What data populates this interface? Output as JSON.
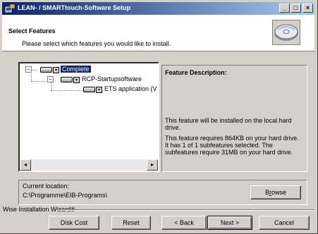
{
  "window": {
    "title": "LEAN- / SMARTtouch-Software Setup",
    "minimize_glyph": "_",
    "maximize_glyph": "□",
    "close_glyph": "×"
  },
  "header": {
    "title": "Select Features",
    "subtitle": "Please select which features you would like to install."
  },
  "tree": {
    "items": [
      {
        "label": "Complete",
        "selected": true,
        "expand": "−"
      },
      {
        "label": "RCP-Startupsoftware",
        "selected": false,
        "expand": "−"
      },
      {
        "label": "ETS application (V",
        "selected": false,
        "expand": ""
      }
    ],
    "dropdown_glyph": "▾",
    "scroll_left": "◂",
    "scroll_right": "▸"
  },
  "description": {
    "title": "Feature Description:",
    "line1": "This feature will be installed on the local hard drive.",
    "line2": "This feature requires 864KB on your hard drive. It has 1 of 1 subfeatures selected. The subfeatures require 31MB on your hard drive."
  },
  "location": {
    "label": "Current location:",
    "path": "C:\\Programme\\EIB-Programs\\",
    "browse_prefix": "B",
    "browse_ul": "r",
    "browse_suffix": "owse"
  },
  "footer": {
    "wizard_label": "Wise Installation Wizard®",
    "disk_cost": "Disk Cost",
    "reset": "Reset",
    "back": "< Back",
    "next": "Next >",
    "cancel": "Cancel"
  },
  "colors": {
    "titlebar_start": "#0a246a",
    "titlebar_end": "#a6caf0",
    "face": "#d4d0c8",
    "selection": "#0a246a"
  }
}
